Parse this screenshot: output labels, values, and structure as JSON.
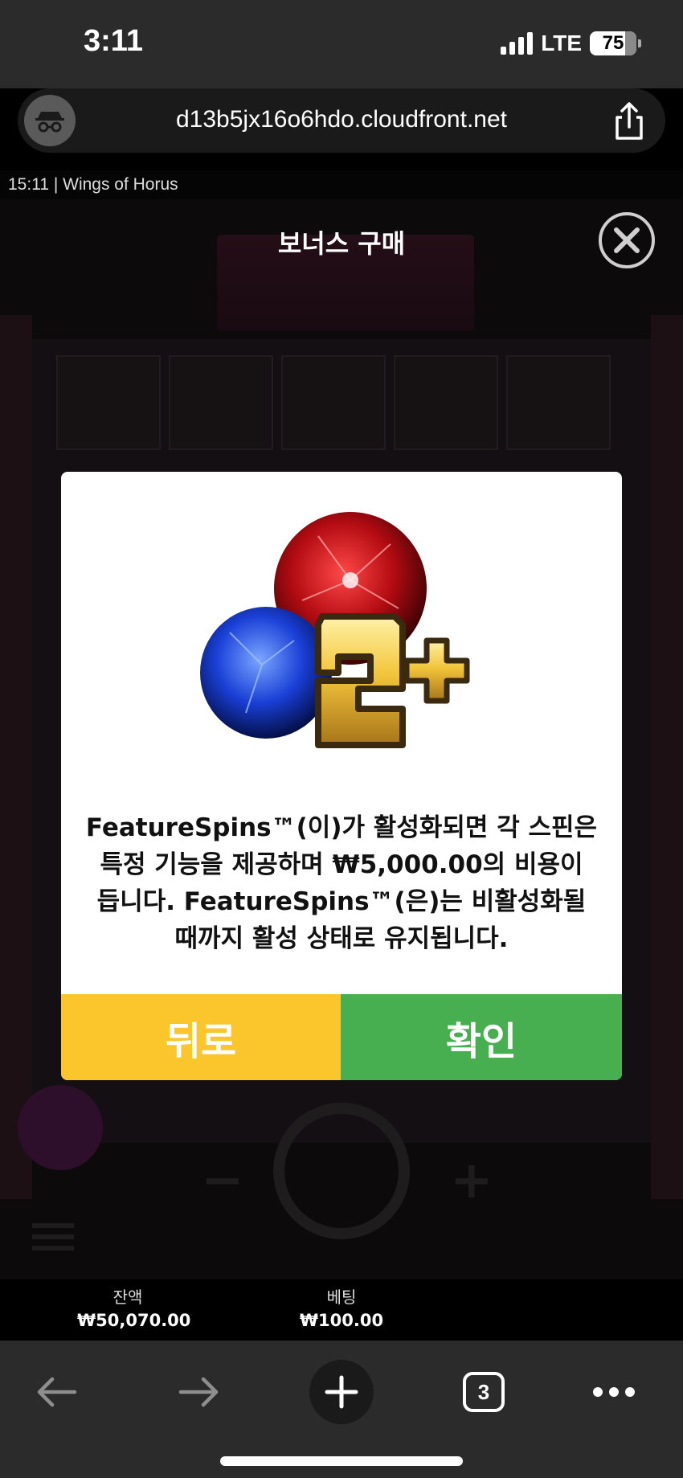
{
  "status_bar": {
    "time": "3:11",
    "network": "LTE",
    "battery": "75"
  },
  "browser": {
    "url": "d13b5jx16o6hdo.cloudfront.net",
    "tab_count": "3"
  },
  "game": {
    "info": "15:11  |  Wings of Horus",
    "bonus_title": "보너스 구매"
  },
  "dialog": {
    "text_lines": [
      "FeatureSpins™(이)가 활성화되면 각 스핀은",
      "특정 기능을 제공하며 ₩5,000.00의 비용이",
      "듭니다. FeatureSpins™(은)는 비활성화될",
      "때까지 활성 상태로 유지됩니다."
    ],
    "badge_text": "2+",
    "back_label": "뒤로",
    "confirm_label": "확인"
  },
  "balance_bar": {
    "balance_label": "잔액",
    "balance_value": "₩50,070.00",
    "bet_label": "베팅",
    "bet_value": "₩100.00"
  },
  "colors": {
    "back_button": "#fbc52c",
    "confirm_button": "#47af4f",
    "background": "#0d0a0b"
  },
  "icons": [
    "incognito-icon",
    "share-icon",
    "close-icon",
    "back-arrow-icon",
    "forward-arrow-icon",
    "plus-icon",
    "more-icon"
  ]
}
